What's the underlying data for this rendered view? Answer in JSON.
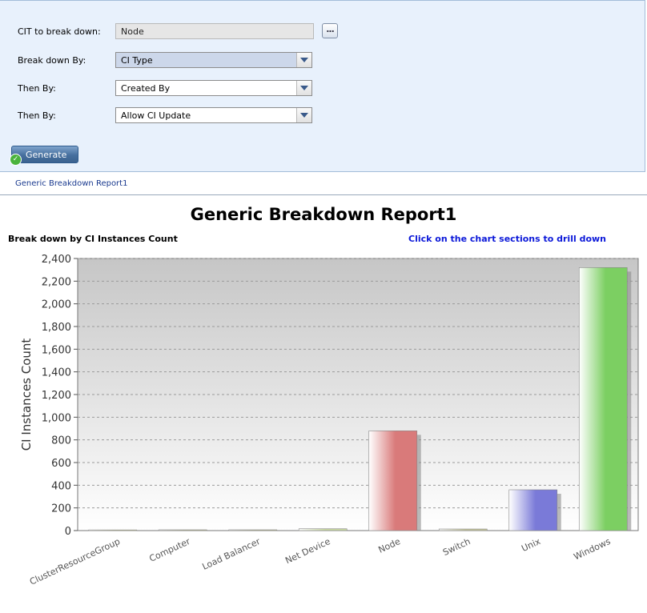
{
  "form": {
    "cit_label": "CIT to break down:",
    "cit_value": "Node",
    "browse_label": "...",
    "breakdown_label": "Break down By:",
    "breakdown_value": "CI Type",
    "then1_label": "Then By:",
    "then1_value": "Created By",
    "then2_label": "Then By:",
    "then2_value": "Allow CI Update",
    "generate_label": "Generate"
  },
  "report_link": "Generic Breakdown Report1",
  "report": {
    "subtitle": "Break down by CI Instances Count",
    "hint": "Click on the chart sections to drill down"
  },
  "colors": {
    "panel_bg": "#e8f1fc",
    "link": "#1a3a8f",
    "hint": "#0c19d9"
  },
  "chart_data": {
    "type": "bar",
    "title": "Generic Breakdown Report1",
    "xlabel": "",
    "ylabel": "CI Instances Count",
    "ylim": [
      0,
      2400
    ],
    "yticks": [
      0,
      200,
      400,
      600,
      800,
      1000,
      1200,
      1400,
      1600,
      1800,
      2000,
      2200,
      2400
    ],
    "ytick_labels": [
      "0",
      "200",
      "400",
      "600",
      "800",
      "1,000",
      "1,200",
      "1,400",
      "1,600",
      "1,800",
      "2,000",
      "2,200",
      "2,400"
    ],
    "grid": true,
    "categories": [
      "ClusterResourceGroup",
      "Computer",
      "Load Balancer",
      "Net Device",
      "Node",
      "Switch",
      "Unix",
      "Windows"
    ],
    "values": [
      6,
      0,
      0,
      16,
      880,
      14,
      360,
      2320
    ],
    "colors": [
      "#c8c89a",
      "#c8c89a",
      "#c8c89a",
      "#c8d8a0",
      "#d97a7a",
      "#c8c89a",
      "#7a7ad8",
      "#7ccf62"
    ]
  }
}
